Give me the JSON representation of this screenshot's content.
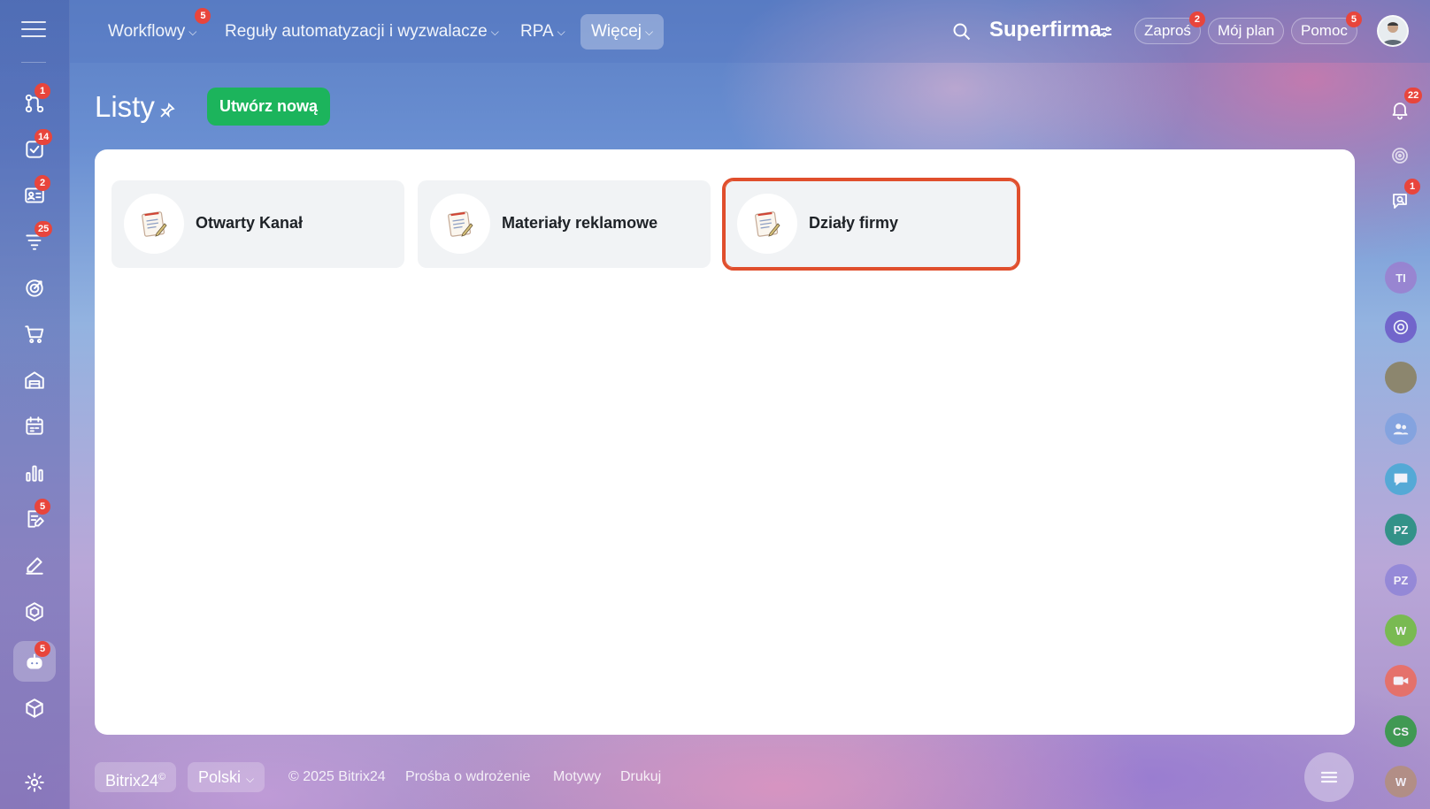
{
  "top_nav": {
    "items": [
      {
        "label": "Workflowy",
        "badge": "5"
      },
      {
        "label": "Reguły automatyzacji i wyzwalacze"
      },
      {
        "label": "RPA"
      },
      {
        "label": "Więcej"
      }
    ],
    "company_name": "Superfirma",
    "invite": {
      "label": "Zaproś",
      "badge": "2"
    },
    "plan_label": "Mój plan",
    "help": {
      "label": "Pomoc",
      "badge": "5"
    }
  },
  "left_sidebar": {
    "badges": {
      "flows": "1",
      "tasks": "14",
      "crm": "2",
      "funnels": "25",
      "docs": "5",
      "automation": "5"
    }
  },
  "page": {
    "title": "Listy",
    "create_button": "Utwórz nową"
  },
  "lists": [
    {
      "label": "Otwarty Kanał"
    },
    {
      "label": "Materiały reklamowe"
    },
    {
      "label": "Działy firmy"
    }
  ],
  "right_sidebar": {
    "notifications_badge": "22",
    "chat_badge": "1",
    "avatars": [
      {
        "initials": "TI",
        "color": "#9b7fd0"
      },
      {
        "initials": "",
        "color": "#6c58c8"
      },
      {
        "initials": "",
        "color": "#8a7f5a"
      },
      {
        "initials": "",
        "color": "#7fa2e0"
      },
      {
        "initials": "",
        "color": "#46a9d6"
      },
      {
        "initials": "PZ",
        "color": "#1d8f7b"
      },
      {
        "initials": "PZ",
        "color": "#8f84d8"
      },
      {
        "initials": "W",
        "color": "#6fbf3c"
      },
      {
        "initials": "",
        "color": "#ee6a5a"
      },
      {
        "initials": "CS",
        "color": "#2e9a3e"
      },
      {
        "initials": "W",
        "color": "#b48f7a"
      }
    ]
  },
  "footer": {
    "brand": "Bitrix24",
    "brand_mark": "©",
    "language": "Polski",
    "copyright": "© 2025 Bitrix24",
    "links": [
      "Prośba o wdrożenie",
      "Motywy",
      "Drukuj"
    ]
  },
  "colors": {
    "create_button": "#1cb45c",
    "selected_outline": "#e04e2c",
    "badge": "#e8453c"
  }
}
